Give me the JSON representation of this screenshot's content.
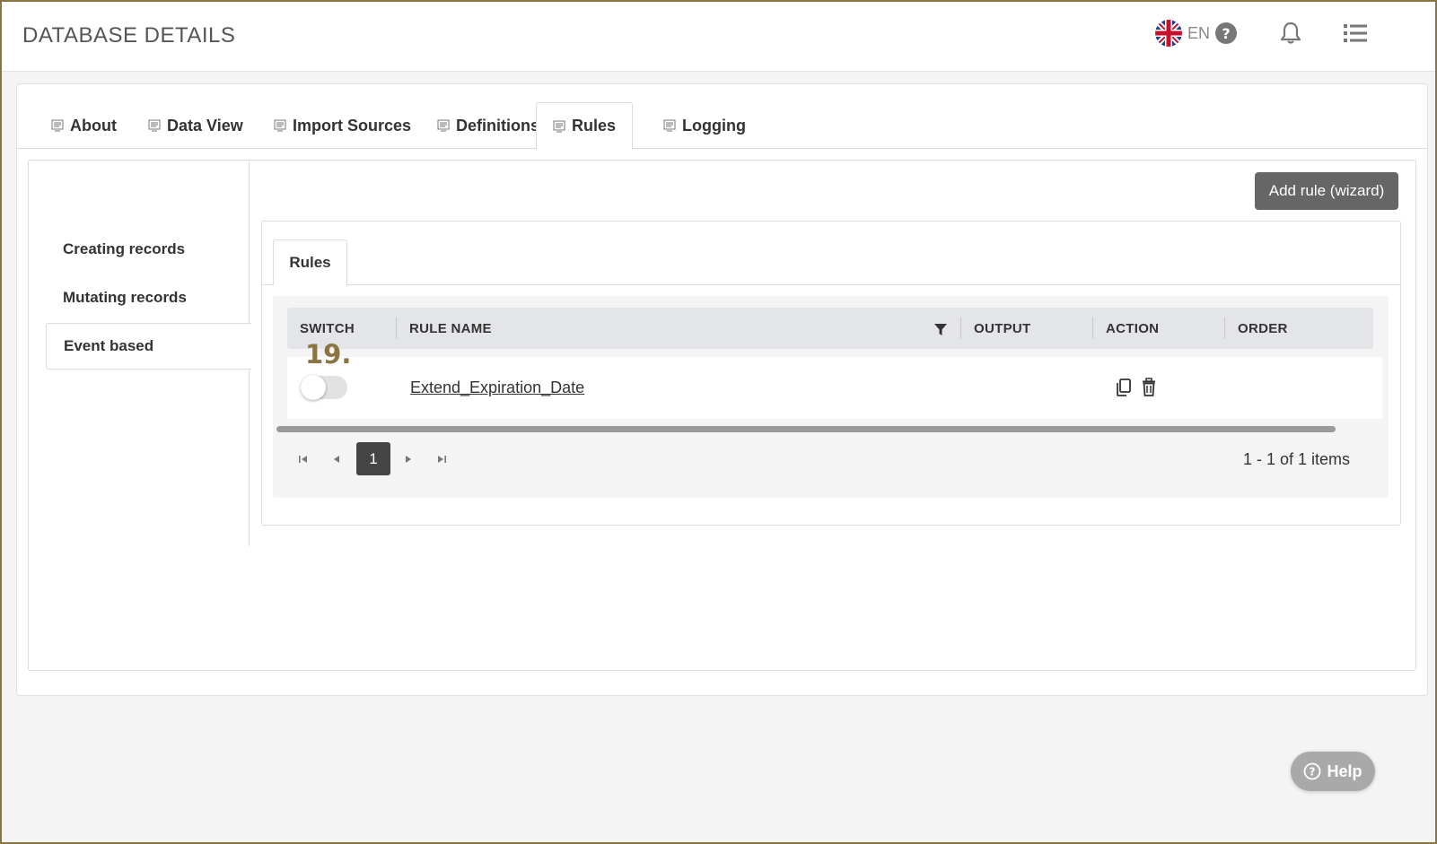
{
  "header": {
    "title": "DATABASE DETAILS",
    "language": "EN"
  },
  "tabs": [
    {
      "label": "About",
      "active": false
    },
    {
      "label": "Data View",
      "active": false
    },
    {
      "label": "Import Sources",
      "active": false
    },
    {
      "label": "Definitions",
      "active": false
    },
    {
      "label": "Rules",
      "active": true
    },
    {
      "label": "Logging",
      "active": false
    }
  ],
  "sidenav": {
    "items": [
      {
        "label": "Creating records",
        "active": false
      },
      {
        "label": "Mutating records",
        "active": false
      },
      {
        "label": "Event based",
        "active": true
      }
    ]
  },
  "toolbar": {
    "add_rule_label": "Add rule (wizard)"
  },
  "rules_panel": {
    "tab_label": "Rules"
  },
  "grid": {
    "columns": [
      "SWITCH",
      "RULE NAME",
      "OUTPUT",
      "ACTION",
      "ORDER"
    ],
    "rows": [
      {
        "marker": "19.",
        "switch_on": false,
        "rule_name": "Extend_Expiration_Date",
        "output": "",
        "order": ""
      }
    ]
  },
  "pager": {
    "current_page": "1",
    "info": "1 - 1 of 1 items"
  },
  "help_button": {
    "label": "Help"
  },
  "colors": {
    "frame": "#8a7441",
    "button_dark": "#666666",
    "pager_active": "#444444",
    "marker": "#8a7441"
  }
}
